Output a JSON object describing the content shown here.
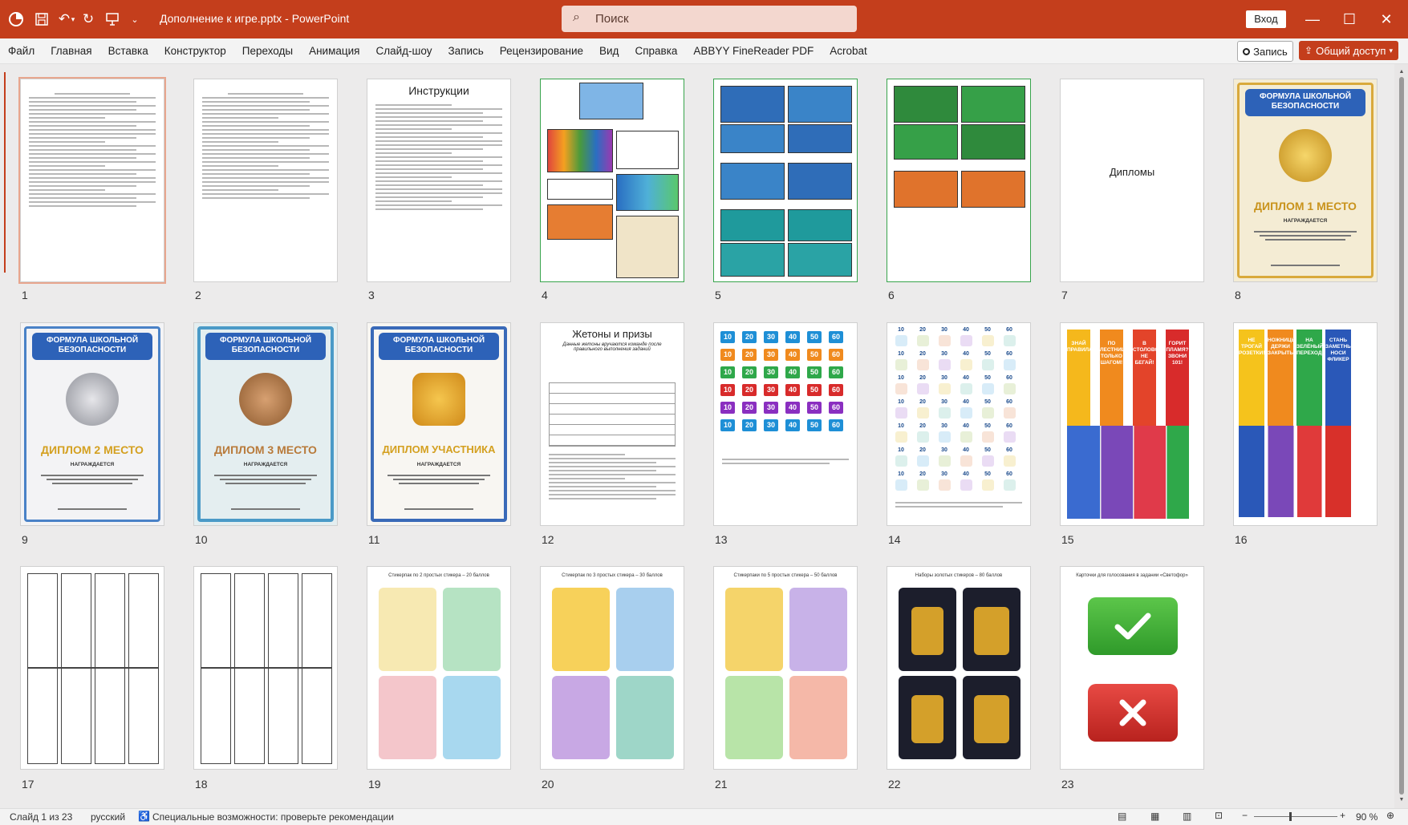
{
  "app": {
    "title": "Дополнение к игре.pptx  -  PowerPoint",
    "search_placeholder": "Поиск",
    "sign_in": "Вход",
    "accent": "#c43e1c"
  },
  "menu": {
    "items": [
      "Файл",
      "Главная",
      "Вставка",
      "Конструктор",
      "Переходы",
      "Анимация",
      "Слайд-шоу",
      "Запись",
      "Рецензирование",
      "Вид",
      "Справка",
      "ABBYY FineReader PDF",
      "Acrobat"
    ],
    "record": "Запись",
    "share": "Общий доступ"
  },
  "slides": {
    "s3_title": "Инструкции",
    "s7_title": "Дипломы",
    "s12_title": "Жетоны и призы",
    "s12_sub": "Данные жетоны вручаются команде после правильного выполнения заданий",
    "s19_title": "Стикерпак по 2 простых стикера – 20 баллов",
    "s20_title": "Стикерпак по 3 простых стикера – 30 баллов",
    "s21_title": "Стикерпаки по 5 простых стикера – 50 баллов",
    "s22_title": "Наборы золотых стикеров – 80 баллов",
    "s23_title": "Карточки для голосования в задании «Светофор»",
    "cert_banner": "ФОРМУЛА ШКОЛЬНОЙ БЕЗОПАСНОСТИ",
    "cert_award": "НАГРАЖДАЕТСЯ",
    "cert8_title": "ДИПЛОМ 1 МЕСТО",
    "cert9_title": "ДИПЛОМ 2 МЕСТО",
    "cert10_title": "ДИПЛОМ 3 МЕСТО",
    "cert11_title": "ДИПЛОМ УЧАСТНИКА",
    "s13_values": [
      10,
      20,
      30,
      40,
      50,
      60
    ],
    "s15_labels": [
      "ЗНАЙ ПРАВИЛА!",
      "ПО ЛЕСТНИЦЕ ТОЛЬКО ШАГОМ!",
      "В СТОЛОВОЙ НЕ БЕГАЙ!",
      "ГОРИТ ПЛАМЯ? ЗВОНИ 101!"
    ],
    "s16_labels": [
      "НЕ ТРОГАЙ РОЗЕТКИ!",
      "НОЖНИЦЫ ДЕРЖИ ЗАКРЫТЫМИ",
      "НА ЗЕЛЁНЫЙ ПЕРЕХОДИ",
      "СТАНЬ ЗАМЕТНЫМ НОСИ ФЛИКЕР"
    ],
    "numbers": [
      "1",
      "2",
      "3",
      "4",
      "5",
      "6",
      "7",
      "8",
      "9",
      "10",
      "11",
      "12",
      "13",
      "14",
      "15",
      "16",
      "17",
      "18",
      "19",
      "20",
      "21",
      "22",
      "23"
    ]
  },
  "status": {
    "slide": "Слайд 1 из 23",
    "language": "русский",
    "accessibility": "Специальные возможности: проверьте рекомендации",
    "zoom": "90 %"
  }
}
